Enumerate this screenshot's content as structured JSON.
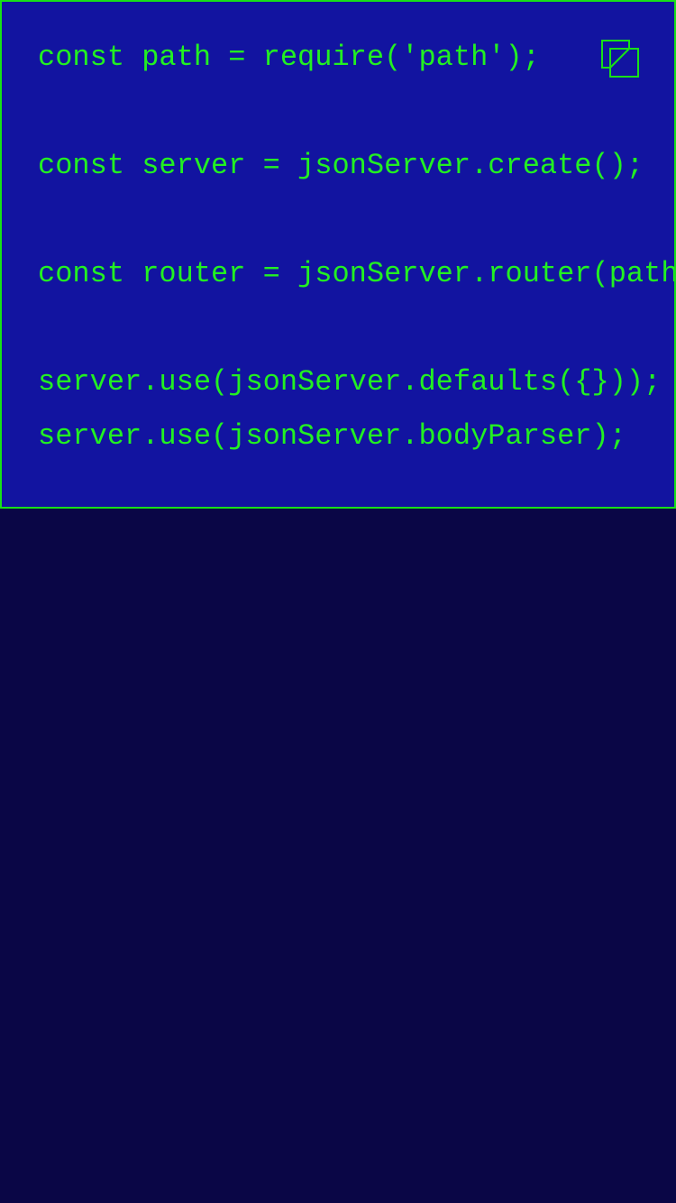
{
  "code_block": {
    "lines": [
      "const path = require('path');",
      "",
      "const server = jsonServer.create();",
      "",
      "const router = jsonServer.router(path",
      "",
      "server.use(jsonServer.defaults({}));",
      "server.use(jsonServer.bodyParser);"
    ],
    "copy_icon": "copy-icon"
  },
  "colors": {
    "code_background": "#1214a0",
    "code_text": "#22f022",
    "border": "#18e018",
    "page_background": "#0a0646"
  }
}
